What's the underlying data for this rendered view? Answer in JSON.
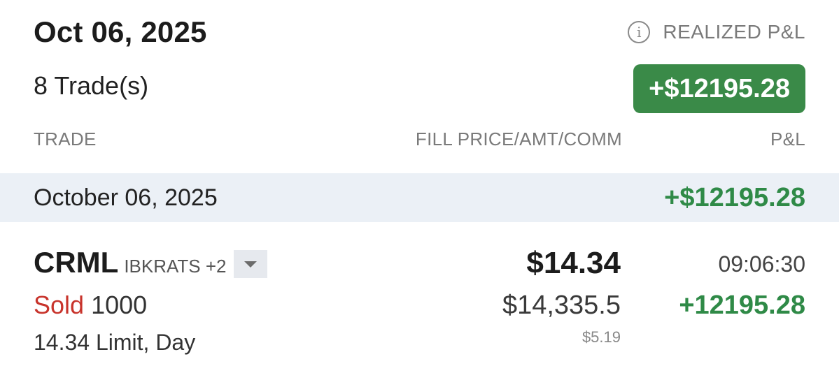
{
  "header": {
    "date": "Oct 06, 2025",
    "trade_count": "8 Trade(s)",
    "realized_label": "REALIZED P&L",
    "realized_pnl": "+$12195.28",
    "info_icon": "info-circle-icon"
  },
  "columns": {
    "trade": "TRADE",
    "fill": "FILL PRICE/AMT/COMM",
    "pnl": "P&L"
  },
  "day_group": {
    "date": "October 06, 2025",
    "pnl": "+$12195.28"
  },
  "trades": [
    {
      "symbol": "CRML",
      "account": "IBKRATS +2",
      "action": "Sold",
      "quantity": "1000",
      "order_detail": "14.34 Limit, Day",
      "fill_price": "$14.34",
      "amount": "$14,335.5",
      "commission": "$5.19",
      "time": "09:06:30",
      "pnl": "+12195.28",
      "expand_icon": "chevron-down-icon"
    }
  ],
  "colors": {
    "profit_green": "#2f8a47",
    "badge_green": "#3a8a48",
    "sold_red": "#c8342c",
    "band_bg": "#ebf0f6"
  }
}
